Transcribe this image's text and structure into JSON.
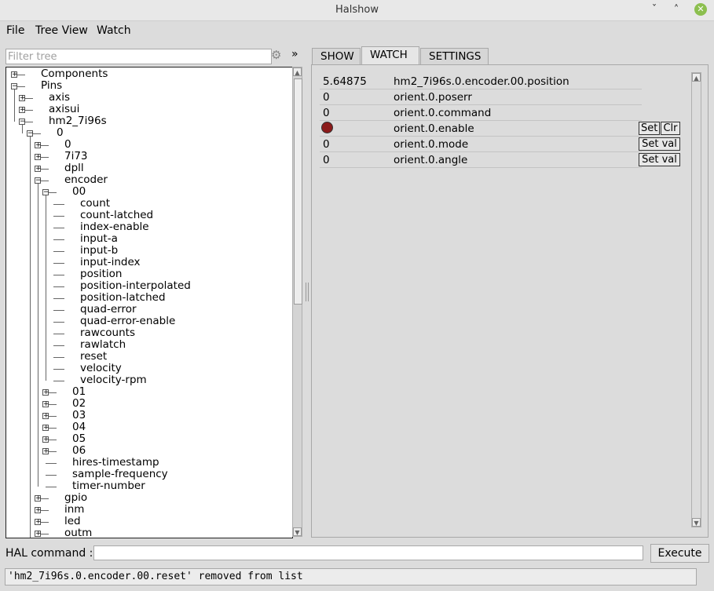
{
  "window": {
    "title": "Halshow",
    "minimize_glyph": "ˇ",
    "maximize_glyph": "˄",
    "close_glyph": "✕"
  },
  "menu": {
    "file": "File",
    "tree_view": "Tree View",
    "watch": "Watch"
  },
  "filter": {
    "placeholder": "Filter tree",
    "gear_icon": "gear-icon",
    "more_glyph": "»"
  },
  "tree": {
    "items": [
      {
        "label": "Components",
        "depth": 0,
        "expander": "+"
      },
      {
        "label": "Pins",
        "depth": 0,
        "expander": "-"
      },
      {
        "label": "axis",
        "depth": 1,
        "expander": "+"
      },
      {
        "label": "axisui",
        "depth": 1,
        "expander": "+"
      },
      {
        "label": "hm2_7i96s",
        "depth": 1,
        "expander": "-"
      },
      {
        "label": "0",
        "depth": 2,
        "expander": "-"
      },
      {
        "label": "0",
        "depth": 3,
        "expander": "+"
      },
      {
        "label": "7i73",
        "depth": 3,
        "expander": "+"
      },
      {
        "label": "dpll",
        "depth": 3,
        "expander": "+"
      },
      {
        "label": "encoder",
        "depth": 3,
        "expander": "-"
      },
      {
        "label": "00",
        "depth": 4,
        "expander": "-"
      },
      {
        "label": "count",
        "depth": 5,
        "expander": ""
      },
      {
        "label": "count-latched",
        "depth": 5,
        "expander": ""
      },
      {
        "label": "index-enable",
        "depth": 5,
        "expander": ""
      },
      {
        "label": "input-a",
        "depth": 5,
        "expander": ""
      },
      {
        "label": "input-b",
        "depth": 5,
        "expander": ""
      },
      {
        "label": "input-index",
        "depth": 5,
        "expander": ""
      },
      {
        "label": "position",
        "depth": 5,
        "expander": ""
      },
      {
        "label": "position-interpolated",
        "depth": 5,
        "expander": ""
      },
      {
        "label": "position-latched",
        "depth": 5,
        "expander": ""
      },
      {
        "label": "quad-error",
        "depth": 5,
        "expander": ""
      },
      {
        "label": "quad-error-enable",
        "depth": 5,
        "expander": ""
      },
      {
        "label": "rawcounts",
        "depth": 5,
        "expander": ""
      },
      {
        "label": "rawlatch",
        "depth": 5,
        "expander": ""
      },
      {
        "label": "reset",
        "depth": 5,
        "expander": ""
      },
      {
        "label": "velocity",
        "depth": 5,
        "expander": ""
      },
      {
        "label": "velocity-rpm",
        "depth": 5,
        "expander": ""
      },
      {
        "label": "01",
        "depth": 4,
        "expander": "+"
      },
      {
        "label": "02",
        "depth": 4,
        "expander": "+"
      },
      {
        "label": "03",
        "depth": 4,
        "expander": "+"
      },
      {
        "label": "04",
        "depth": 4,
        "expander": "+"
      },
      {
        "label": "05",
        "depth": 4,
        "expander": "+"
      },
      {
        "label": "06",
        "depth": 4,
        "expander": "+"
      },
      {
        "label": "hires-timestamp",
        "depth": 4,
        "expander": ""
      },
      {
        "label": "sample-frequency",
        "depth": 4,
        "expander": ""
      },
      {
        "label": "timer-number",
        "depth": 4,
        "expander": ""
      },
      {
        "label": "gpio",
        "depth": 3,
        "expander": "+"
      },
      {
        "label": "inm",
        "depth": 3,
        "expander": "+"
      },
      {
        "label": "led",
        "depth": 3,
        "expander": "+"
      },
      {
        "label": "outm",
        "depth": 3,
        "expander": "+"
      }
    ]
  },
  "tabs": {
    "show": "SHOW",
    "watch": "WATCH",
    "settings": "SETTINGS",
    "active": "WATCH"
  },
  "watch": {
    "rows": [
      {
        "value": "5.64875",
        "name": "hm2_7i96s.0.encoder.00.position",
        "type": "value",
        "buttons": []
      },
      {
        "value": "0",
        "name": "orient.0.poserr",
        "type": "value",
        "buttons": []
      },
      {
        "value": "0",
        "name": "orient.0.command",
        "type": "value",
        "buttons": []
      },
      {
        "value": "",
        "name": "orient.0.enable",
        "type": "led",
        "led_color": "#8b1a1a",
        "buttons": [
          "Set",
          "Clr"
        ]
      },
      {
        "value": "0",
        "name": "orient.0.mode",
        "type": "value",
        "buttons": [
          "Set val"
        ]
      },
      {
        "value": "0",
        "name": "orient.0.angle",
        "type": "value",
        "buttons": [
          "Set val"
        ]
      }
    ]
  },
  "hal": {
    "label": "HAL command :",
    "value": "",
    "execute_label": "Execute"
  },
  "status": {
    "text": "'hm2_7i96s.0.encoder.00.reset' removed from list"
  }
}
